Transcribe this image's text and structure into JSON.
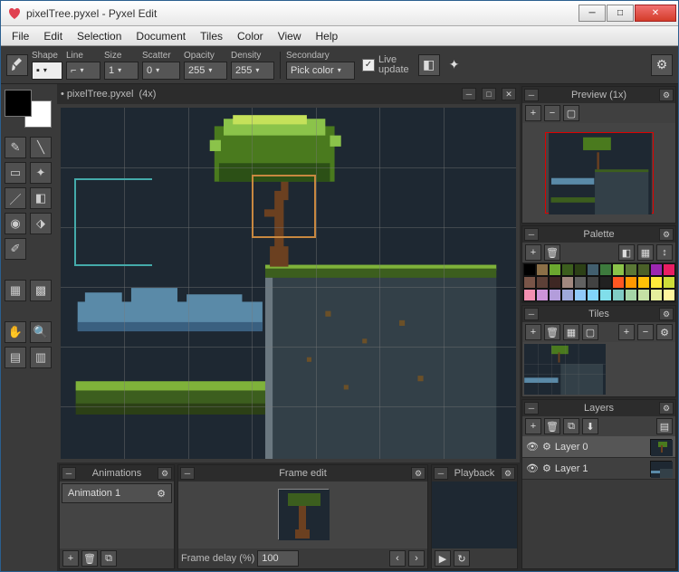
{
  "window": {
    "title": "pixelTree.pyxel - Pyxel Edit"
  },
  "menu": [
    "File",
    "Edit",
    "Selection",
    "Document",
    "Tiles",
    "Color",
    "View",
    "Help"
  ],
  "toolbar": {
    "shape": "Shape",
    "line": "Line",
    "size": "Size",
    "size_val": "1",
    "scatter": "Scatter",
    "scatter_val": "0",
    "opacity": "Opacity",
    "opacity_val": "255",
    "density": "Density",
    "density_val": "255",
    "secondary": "Secondary",
    "pickcolor": "Pick color",
    "live": "Live",
    "update": "update"
  },
  "tab": {
    "name": "• pixelTree.pyxel",
    "zoom": "(4x)"
  },
  "panels": {
    "preview": "Preview (1x)",
    "palette": "Palette",
    "tiles": "Tiles",
    "layers": "Layers",
    "animations": "Animations",
    "frameedit": "Frame edit",
    "playback": "Playback"
  },
  "animations": {
    "item1": "Animation 1"
  },
  "frameedit": {
    "delay_label": "Frame delay (%)",
    "delay_val": "100"
  },
  "layers": {
    "l0": "Layer 0",
    "l1": "Layer 1"
  },
  "palette_colors": [
    "#000000",
    "#8b6f47",
    "#6ba82f",
    "#3c5e1e",
    "#2c4016",
    "#425f6f",
    "#3d7a3d",
    "#8bc34a",
    "#5a7836",
    "#4a6028",
    "#9c27b0",
    "#e91e63",
    "#795548",
    "#5d4037",
    "#3e2723",
    "#a1887f",
    "#616161",
    "#424242",
    "#212121",
    "#ff5722",
    "#ff9800",
    "#ffc107",
    "#ffeb3b",
    "#cddc39",
    "#f48fb1",
    "#ce93d8",
    "#b39ddb",
    "#9fa8da",
    "#90caf9",
    "#81d4fa",
    "#80deea",
    "#80cbc4",
    "#a5d6a7",
    "#c5e1a5",
    "#e6ee9c",
    "#fff59d"
  ]
}
